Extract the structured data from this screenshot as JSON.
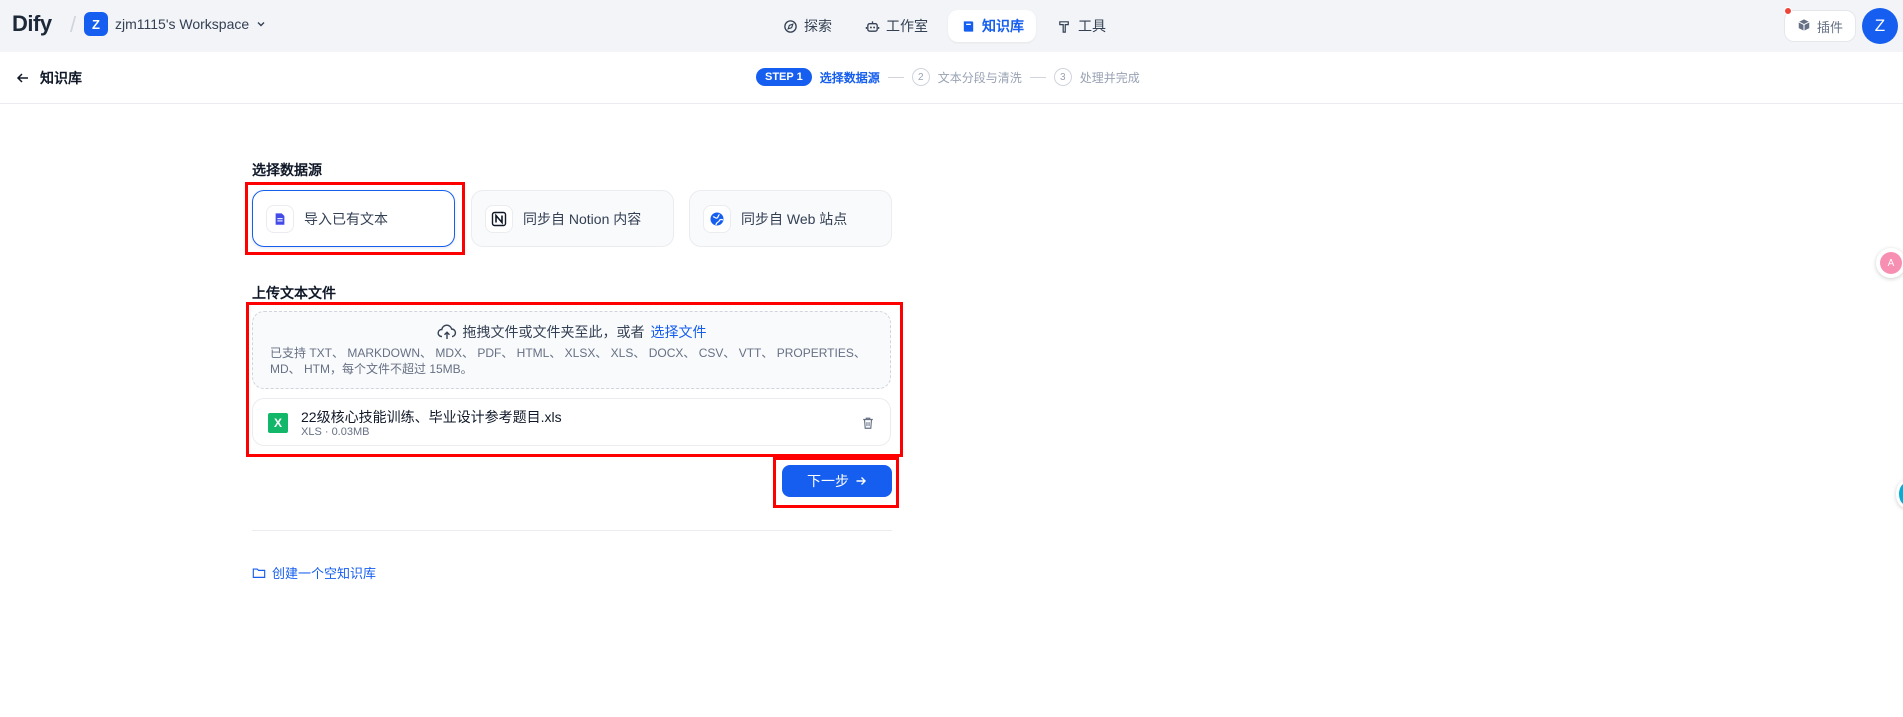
{
  "header": {
    "logo": "Dify",
    "workspace": {
      "initial": "Z",
      "name": "zjm1115's Workspace"
    },
    "nav": [
      {
        "label": "探索",
        "icon": "compass-icon"
      },
      {
        "label": "工作室",
        "icon": "robot-icon"
      },
      {
        "label": "知识库",
        "icon": "book-icon",
        "active": true
      },
      {
        "label": "工具",
        "icon": "hammer-icon"
      }
    ],
    "plugin_label": "插件",
    "user_initial": "Z"
  },
  "subheader": {
    "back_label": "知识库",
    "steps": [
      {
        "badge": "STEP 1",
        "label": "选择数据源",
        "active": true
      },
      {
        "num": "2",
        "label": "文本分段与清洗"
      },
      {
        "num": "3",
        "label": "处理并完成"
      }
    ]
  },
  "datasource": {
    "title": "选择数据源",
    "options": [
      {
        "label": "导入已有文本",
        "icon": "file-text-icon",
        "active": true
      },
      {
        "label": "同步自 Notion 内容",
        "icon": "notion-icon"
      },
      {
        "label": "同步自 Web 站点",
        "icon": "globe-icon"
      }
    ]
  },
  "upload": {
    "title": "上传文本文件",
    "drop_text": "拖拽文件或文件夹至此，或者",
    "select_link": "选择文件",
    "hint": "已支持 TXT、 MARKDOWN、 MDX、 PDF、 HTML、 XLSX、 XLS、 DOCX、 CSV、 VTT、 PROPERTIES、 MD、 HTM，每个文件不超过 15MB。",
    "file": {
      "icon_letter": "X",
      "name": "22级核心技能训练、毕业设计参考题目.xls",
      "meta": "XLS · 0.03MB"
    }
  },
  "actions": {
    "next_label": "下一步",
    "create_empty_label": "创建一个空知识库"
  },
  "colors": {
    "primary": "#155eef",
    "highlight": "#ff0000",
    "file_green": "#12b76a"
  }
}
